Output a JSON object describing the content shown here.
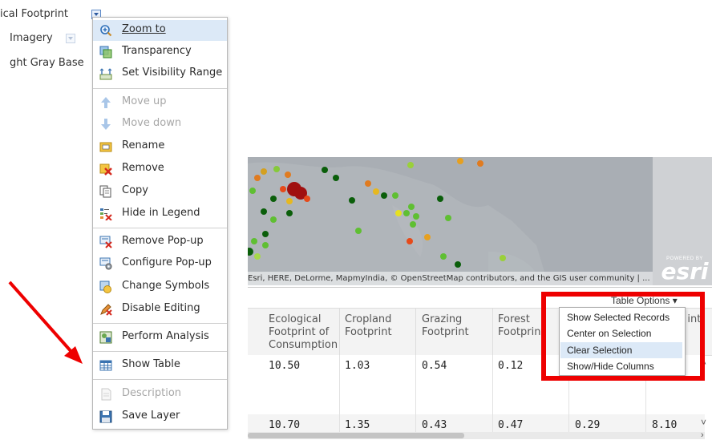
{
  "layers": [
    {
      "label": "ical Footprint",
      "has_menu_button": true,
      "active": true
    },
    {
      "label": "Imagery",
      "has_menu_button": true,
      "active": false
    },
    {
      "label": "ght Gray Base",
      "has_menu_button": false,
      "active": false
    }
  ],
  "context_menu": {
    "items": [
      {
        "label": "Zoom to",
        "icon": "zoom-to-icon",
        "highlighted": true,
        "disabled": false
      },
      {
        "label": "Transparency",
        "icon": "transparency-icon",
        "disabled": false
      },
      {
        "label": "Set Visibility Range",
        "icon": "visibility-range-icon",
        "disabled": false
      },
      {
        "label": "Move up",
        "icon": "arrow-up-icon",
        "disabled": true
      },
      {
        "label": "Move down",
        "icon": "arrow-down-icon",
        "disabled": true
      },
      {
        "label": "Rename",
        "icon": "rename-icon",
        "disabled": false
      },
      {
        "label": "Remove",
        "icon": "remove-icon",
        "disabled": false
      },
      {
        "label": "Copy",
        "icon": "copy-icon",
        "disabled": false
      },
      {
        "label": "Hide in Legend",
        "icon": "hide-legend-icon",
        "disabled": false
      },
      {
        "label": "Remove Pop-up",
        "icon": "remove-popup-icon",
        "disabled": false
      },
      {
        "label": "Configure Pop-up",
        "icon": "configure-popup-icon",
        "disabled": false
      },
      {
        "label": "Change Symbols",
        "icon": "change-symbols-icon",
        "disabled": false
      },
      {
        "label": "Disable Editing",
        "icon": "disable-editing-icon",
        "disabled": false
      },
      {
        "label": "Perform Analysis",
        "icon": "analysis-icon",
        "disabled": false
      },
      {
        "label": "Show Table",
        "icon": "table-icon",
        "disabled": false
      },
      {
        "label": "Description",
        "icon": "description-icon",
        "disabled": true
      },
      {
        "label": "Save Layer",
        "icon": "save-icon",
        "disabled": false
      }
    ]
  },
  "map": {
    "attribution": "Esri, HERE, DeLorme, MapmyIndia, © OpenStreetMap contributors, and the GIS user community | ...",
    "logo_powered_by": "POWERED BY",
    "logo_text": "esri"
  },
  "table": {
    "options_label": "Table Options ▾",
    "close_label": "›",
    "columns": [
      "Ecological Footprint of Consumption",
      "Cropland Footprint",
      "Grazing Footprint",
      "Forest Footprint",
      "",
      "n int"
    ],
    "rows": [
      [
        "10.50",
        "1.03",
        "0.54",
        "0.12",
        "",
        ""
      ],
      [
        "10.70",
        "1.35",
        "0.43",
        "0.47",
        "0.29",
        "8.10"
      ]
    ],
    "options_menu": [
      {
        "label": "Show Selected Records",
        "highlighted": false
      },
      {
        "label": "Center on Selection",
        "highlighted": false
      },
      {
        "label": "Clear Selection",
        "highlighted": true
      },
      {
        "label": "Show/Hide Columns",
        "highlighted": false
      }
    ]
  },
  "colors": {
    "highlight": "#dce9f7",
    "annotation_red": "#ee0000",
    "map_bg": "#a9aeb4"
  }
}
